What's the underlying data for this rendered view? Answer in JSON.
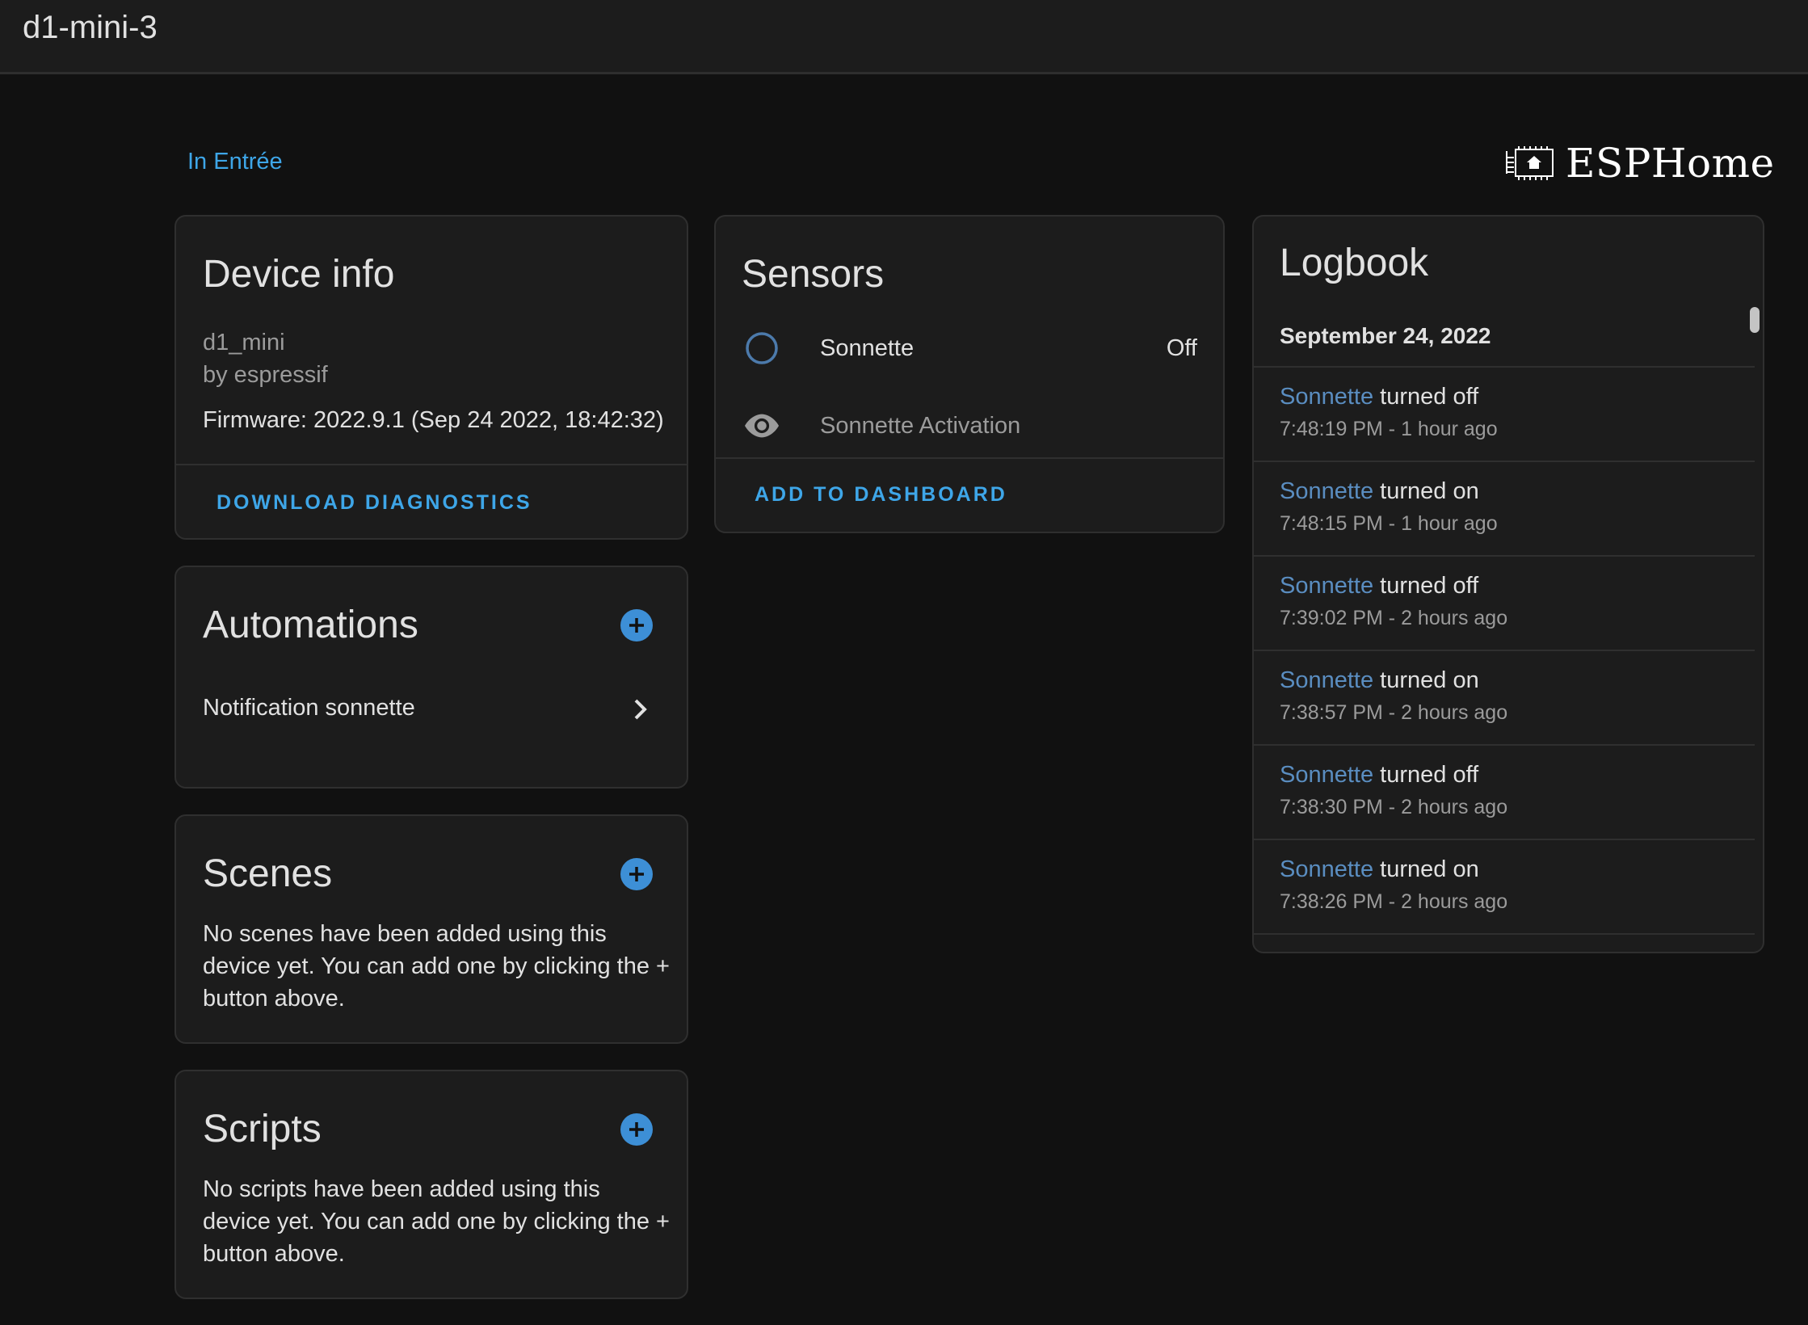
{
  "header": {
    "title": "d1-mini-3"
  },
  "area": {
    "label": "In Entrée"
  },
  "brand": {
    "name": "ESPHome",
    "icon": "esphome-chip-icon"
  },
  "colors": {
    "accent": "#3ea6e8",
    "add_button": "#3d8fd6",
    "entity_link": "#5a8dc0",
    "sensor_off_ring": "#4c7aab"
  },
  "device_info": {
    "title": "Device info",
    "model": "d1_mini",
    "manufacturer": "by espressif",
    "firmware": "Firmware: 2022.9.1 (Sep 24 2022, 18:42:32)",
    "action": "DOWNLOAD DIAGNOSTICS"
  },
  "sensors": {
    "title": "Sensors",
    "items": [
      {
        "name": "Sonnette",
        "state": "Off",
        "icon": "circle-outline-icon"
      },
      {
        "name": "Sonnette Activation",
        "state": "",
        "icon": "eye-icon"
      }
    ],
    "action": "ADD TO DASHBOARD"
  },
  "automations": {
    "title": "Automations",
    "items": [
      {
        "label": "Notification sonnette"
      }
    ]
  },
  "scenes": {
    "title": "Scenes",
    "empty": "No scenes have been added using this device yet. You can add one by clicking the + button above."
  },
  "scripts": {
    "title": "Scripts",
    "empty": "No scripts have been added using this device yet. You can add one by clicking the + button above."
  },
  "logbook": {
    "title": "Logbook",
    "date": "September 24, 2022",
    "entries": [
      {
        "entity": "Sonnette",
        "message": "turned off",
        "time": "7:48:19 PM - 1 hour ago"
      },
      {
        "entity": "Sonnette",
        "message": "turned on",
        "time": "7:48:15 PM - 1 hour ago"
      },
      {
        "entity": "Sonnette",
        "message": "turned off",
        "time": "7:39:02 PM - 2 hours ago"
      },
      {
        "entity": "Sonnette",
        "message": "turned on",
        "time": "7:38:57 PM - 2 hours ago"
      },
      {
        "entity": "Sonnette",
        "message": "turned off",
        "time": "7:38:30 PM - 2 hours ago"
      },
      {
        "entity": "Sonnette",
        "message": "turned on",
        "time": "7:38:26 PM - 2 hours ago"
      }
    ]
  }
}
